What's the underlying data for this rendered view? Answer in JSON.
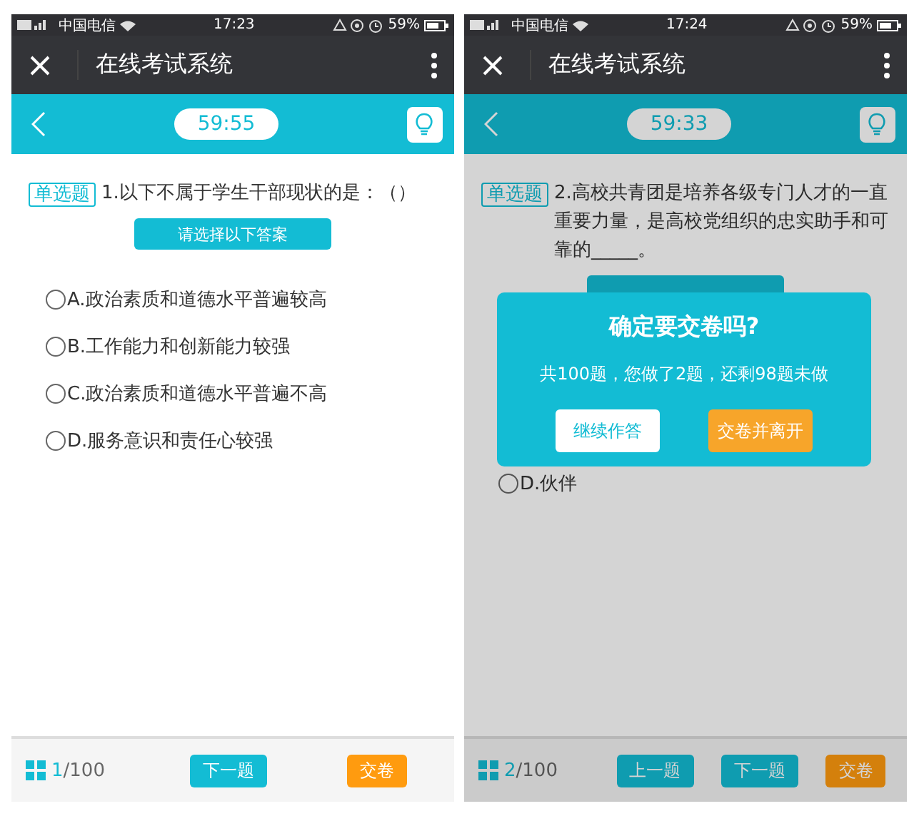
{
  "phones": [
    {
      "status_bar": {
        "carrier": "中国电信",
        "time": "17:23",
        "battery": "59%"
      },
      "app_bar": {
        "title": "在线考试系统"
      },
      "timer": "59:55",
      "question": {
        "tag": "单选题",
        "text": "1.以下不属于学生干部现状的是：（）"
      },
      "prompt_button": "请选择以下答案",
      "options": [
        {
          "label": "A.政治素质和道德水平普遍较高",
          "selected": false
        },
        {
          "label": "B.工作能力和创新能力较强",
          "selected": false
        },
        {
          "label": "C.政治素质和道德水平普遍不高",
          "selected": false
        },
        {
          "label": "D.服务意识和责任心较强",
          "selected": false
        }
      ],
      "footer": {
        "current": "1",
        "total": "/100",
        "buttons": [
          {
            "label": "下一题",
            "kind": "nav"
          },
          {
            "label": "交卷",
            "kind": "submit"
          }
        ]
      }
    },
    {
      "status_bar": {
        "carrier": "中国电信",
        "time": "17:24",
        "battery": "59%"
      },
      "app_bar": {
        "title": "在线考试系统"
      },
      "timer": "59:33",
      "question": {
        "tag": "单选题",
        "text": "2.高校共青团是培养各级专门人才的一直重要力量，是高校党组织的忠实助手和可靠的_____。"
      },
      "options": [
        {
          "label": "D.伙伴",
          "selected": false
        }
      ],
      "footer": {
        "current": "2",
        "total": "/100",
        "buttons": [
          {
            "label": "上一题",
            "kind": "nav"
          },
          {
            "label": "下一题",
            "kind": "nav"
          },
          {
            "label": "交卷",
            "kind": "submit"
          }
        ]
      },
      "dialog": {
        "title": "确定要交卷吗?",
        "message": "共100题，您做了2题，还剩98题未做",
        "buttons": [
          {
            "label": "继续作答",
            "kind": "secondary"
          },
          {
            "label": "交卷并离开",
            "kind": "primary"
          }
        ]
      }
    }
  ]
}
